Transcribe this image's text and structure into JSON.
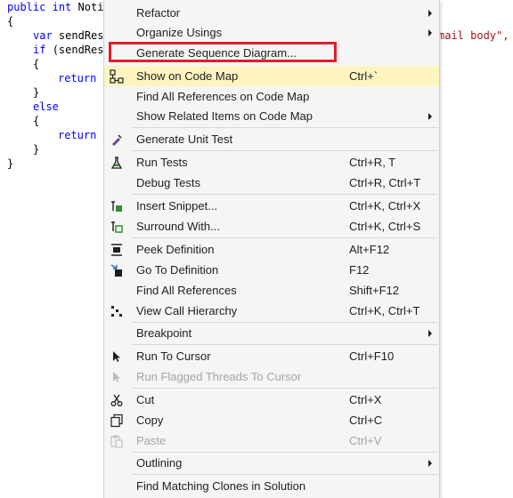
{
  "code": {
    "line1_kw1": "public",
    "line1_kw2": "int",
    "line1_text": "Noti",
    "line2": "{",
    "line3_kw": "var",
    "line3_text": "sendRes",
    "line3_tail": "mail body\",",
    "line4_kw": "if",
    "line4_text": "(sendRes",
    "line5": "{",
    "line6_kw": "return",
    "line7": "}",
    "line8_kw": "else",
    "line9": "{",
    "line10_kw": "return",
    "line10_tail": "(",
    "line11": "}",
    "line12": "}"
  },
  "menu": {
    "items": [
      {
        "label": "Refactor",
        "shortcut": "",
        "icon": "",
        "submenu": true
      },
      {
        "label": "Organize Usings",
        "shortcut": "",
        "icon": "",
        "submenu": true
      },
      {
        "label": "Generate Sequence Diagram...",
        "shortcut": "",
        "icon": ""
      },
      {
        "label": "Show on Code Map",
        "shortcut": "Ctrl+`",
        "icon": "code-map-icon"
      },
      {
        "label": "Find All References on Code Map",
        "shortcut": "",
        "icon": ""
      },
      {
        "label": "Show Related Items on Code Map",
        "shortcut": "",
        "icon": "",
        "submenu": true
      },
      {
        "label": "Generate Unit Test",
        "shortcut": "",
        "icon": "unit-test-icon"
      },
      {
        "label": "Run Tests",
        "shortcut": "Ctrl+R, T",
        "icon": "flask-icon"
      },
      {
        "label": "Debug Tests",
        "shortcut": "Ctrl+R, Ctrl+T",
        "icon": ""
      },
      {
        "label": "Insert Snippet...",
        "shortcut": "Ctrl+K, Ctrl+X",
        "icon": "snippet-icon"
      },
      {
        "label": "Surround With...",
        "shortcut": "Ctrl+K, Ctrl+S",
        "icon": "surround-icon"
      },
      {
        "label": "Peek Definition",
        "shortcut": "Alt+F12",
        "icon": "peek-icon"
      },
      {
        "label": "Go To Definition",
        "shortcut": "F12",
        "icon": "goto-definition-icon"
      },
      {
        "label": "Find All References",
        "shortcut": "Shift+F12",
        "icon": ""
      },
      {
        "label": "View Call Hierarchy",
        "shortcut": "Ctrl+K, Ctrl+T",
        "icon": "call-hierarchy-icon"
      },
      {
        "label": "Breakpoint",
        "shortcut": "",
        "icon": "",
        "submenu": true
      },
      {
        "label": "Run To Cursor",
        "shortcut": "Ctrl+F10",
        "icon": "cursor-icon"
      },
      {
        "label": "Run Flagged Threads To Cursor",
        "shortcut": "",
        "icon": "cursor-icon",
        "disabled": true
      },
      {
        "label": "Cut",
        "shortcut": "Ctrl+X",
        "icon": "scissors-icon"
      },
      {
        "label": "Copy",
        "shortcut": "Ctrl+C",
        "icon": "copy-icon"
      },
      {
        "label": "Paste",
        "shortcut": "Ctrl+V",
        "icon": "paste-icon",
        "disabled": true
      },
      {
        "label": "Outlining",
        "shortcut": "",
        "icon": "",
        "submenu": true
      },
      {
        "label": "Find Matching Clones in Solution",
        "shortcut": "",
        "icon": ""
      }
    ]
  },
  "colors": {
    "hover": "#fdf4bf",
    "highlight_border": "#e01e2b",
    "menu_bg": "#f5f5f5",
    "keyword": "#0000ff",
    "string": "#a31515"
  }
}
